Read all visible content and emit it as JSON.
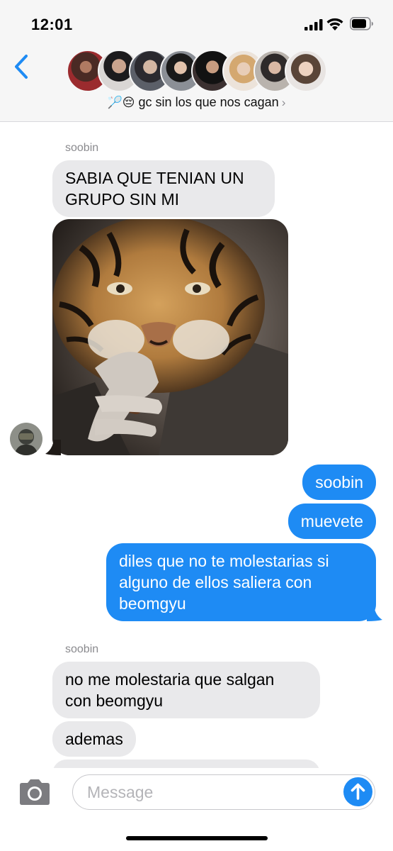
{
  "status_bar": {
    "time": "12:01"
  },
  "header": {
    "group_name": "gc sin los que nos cagan",
    "group_emojis": "🏸😔",
    "chevron": "›",
    "member_count_shown": 8
  },
  "messages": [
    {
      "type": "sender",
      "text": "soobin"
    },
    {
      "type": "incoming",
      "lines": [
        "SABIA QUE TENIAN UN",
        "GRUPO SIN MI"
      ]
    },
    {
      "type": "incoming-image",
      "icon": "tiger-photo"
    },
    {
      "type": "outgoing",
      "text": "soobin"
    },
    {
      "type": "outgoing",
      "text": "muevete"
    },
    {
      "type": "outgoing",
      "lines": [
        "diles que no te molestarias si",
        "alguno de ellos saliera con",
        "beomgyu"
      ]
    },
    {
      "type": "sender",
      "text": "soobin"
    },
    {
      "type": "incoming",
      "lines": [
        "no me molestaria que salgan",
        "con beomgyu"
      ]
    },
    {
      "type": "incoming",
      "text": "ademas"
    }
  ],
  "composer": {
    "placeholder": "Message",
    "value": ""
  },
  "colors": {
    "outgoing": "#1e8bf4",
    "incoming": "#e9e9eb",
    "header": "#f6f6f6"
  }
}
